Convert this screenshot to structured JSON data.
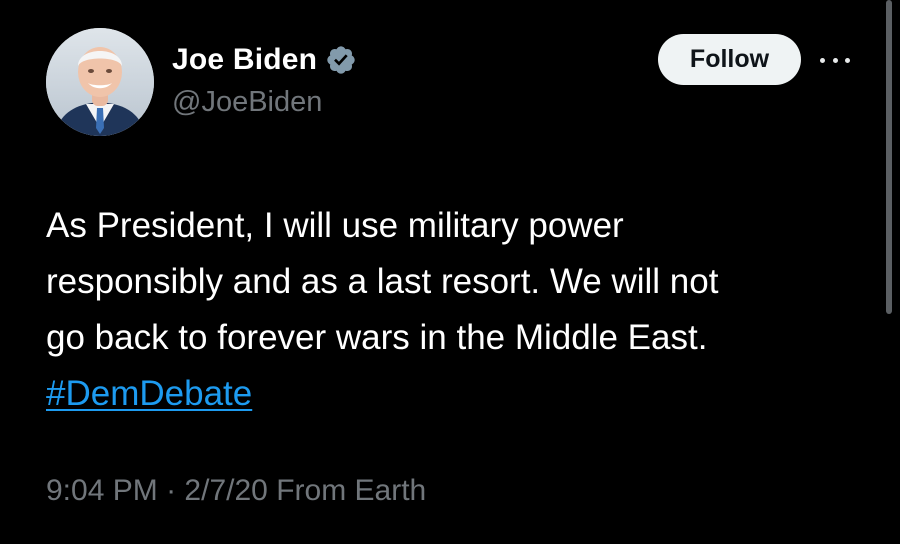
{
  "author": {
    "display_name": "Joe Biden",
    "handle": "@JoeBiden",
    "verified_icon": "verified-badge-icon"
  },
  "actions": {
    "follow_label": "Follow",
    "more_icon": "more-options-icon"
  },
  "tweet": {
    "lines": [
      "As President, I will use military power",
      "responsibly and as a last resort. We will not",
      "go back to forever wars in the Middle East."
    ],
    "hashtag": "#DemDebate",
    "time": "9:04 PM",
    "separator": "·",
    "date": "2/7/20",
    "source": "From Earth"
  },
  "colors": {
    "background": "#000000",
    "text": "#ffffff",
    "secondary_text": "#71767b",
    "link": "#1d9bf0",
    "follow_button_bg": "#eff3f4",
    "verified": "#829aab"
  }
}
